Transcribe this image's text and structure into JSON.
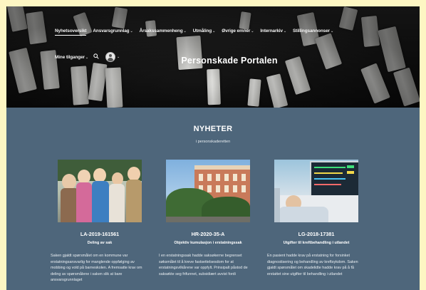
{
  "nav": {
    "items": [
      {
        "label": "Nyhetsoversikt",
        "caret": false,
        "active": true
      },
      {
        "label": "Ansvarsgrunnlag",
        "caret": true,
        "active": false
      },
      {
        "label": "Årsakssammenheng",
        "caret": true,
        "active": false
      },
      {
        "label": "Utmåling",
        "caret": true,
        "active": false
      },
      {
        "label": "Øvrige emner",
        "caret": true,
        "active": false
      },
      {
        "label": "Internarkiv",
        "caret": true,
        "active": false
      },
      {
        "label": "Stillingsannonser",
        "caret": true,
        "active": false
      }
    ],
    "row2": {
      "label": "Mine tilganger",
      "caret": true
    },
    "caret_glyph": "⌄",
    "search_icon": "search-icon",
    "avatar_icon": "user-avatar-icon"
  },
  "hero": {
    "title": "Personskade Portalen"
  },
  "news": {
    "heading": "NYHETER",
    "subheading": "i personskaderetten",
    "cards": [
      {
        "id": "LA-2019-161561",
        "tag": "Deling av sak",
        "text": "Saken gjaldt spørsmålet om en kommune var erstatningsansvarlig for manglende oppfølging av mobbing og vold på barneskolen. A fremsatte krav om deling av spørsmålene i saken slik at bare ansvarsgrunnlaget"
      },
      {
        "id": "HR-2020-35-A",
        "tag": "Objektiv kumulasjon i erstatningssak",
        "text": "I en erstatningssak hadde saksøkerne begrenset søksmålet til å kreve fastsettelsesdom for at erstatningsvilkårene var oppfylt. Prinsipalt påstod de saksøkte seg frifunnet, subsidiært avvist fordi"
      },
      {
        "id": "LG-2018-17381",
        "tag": "Utgifter til kreftbehandling i utlandet",
        "text": "En pasient hadde krav på erstatning for forsinket diagnostisering og behandling av kreftsykdom. Saken gjaldt spørsmålet om skadelidte hadde krav på å få erstattet sine utgifter til behandling i utlandet"
      }
    ]
  }
}
